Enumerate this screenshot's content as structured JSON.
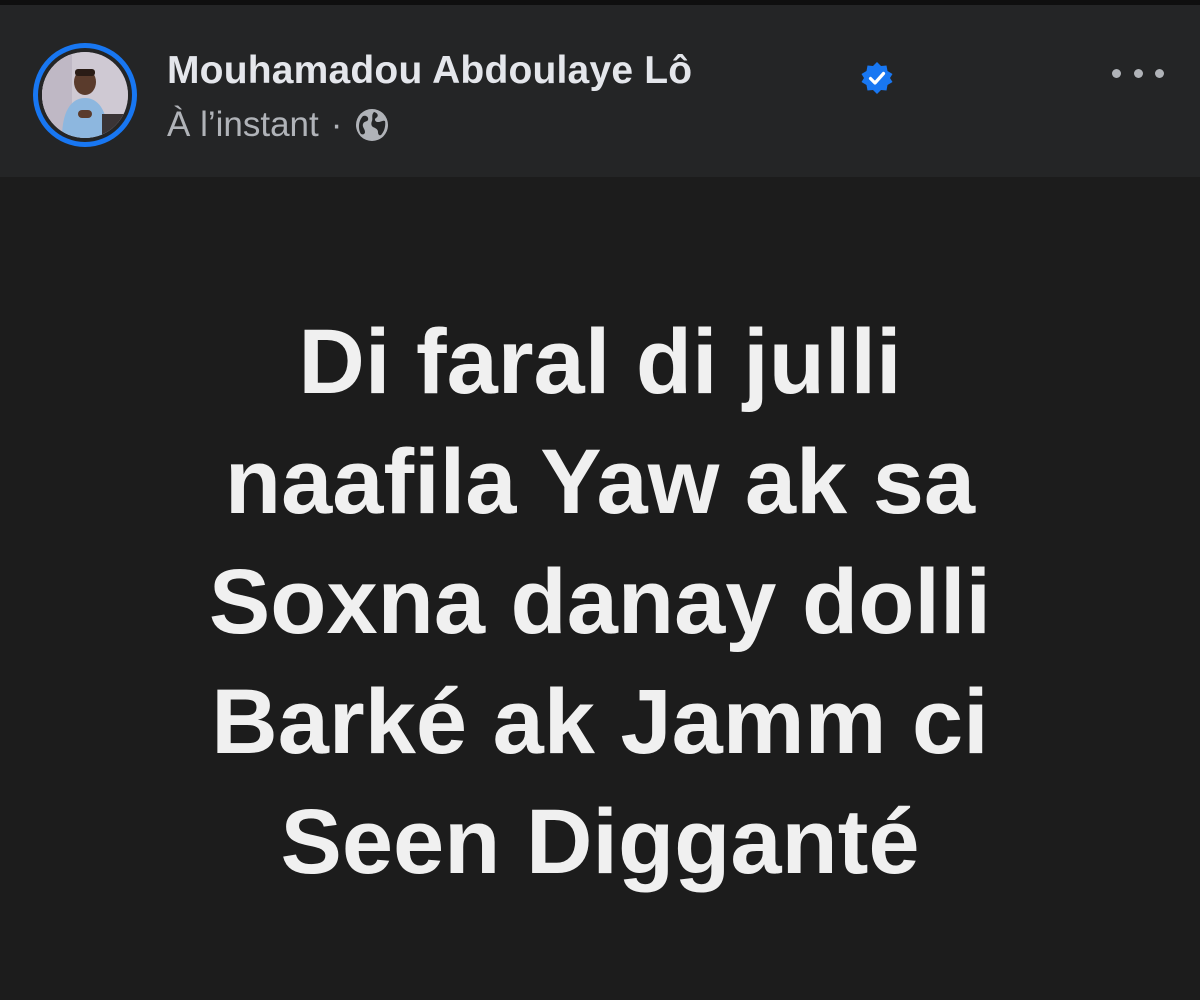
{
  "post": {
    "author_name": "Mouhamadou Abdoulaye Lô",
    "verified": true,
    "timestamp": "À l’instant",
    "separator": "·",
    "audience_icon": "globe-icon",
    "more_icon": "more-options-icon",
    "avatar": "author-avatar",
    "text": "Di faral di julli\nnaafila Yaw ak  sa\nSoxna danay dolli\nBarké ak Jamm ci\nSeen Digganté"
  },
  "colors": {
    "header_background": "#242526",
    "body_background": "#1c1c1c",
    "accent": "#1877f2",
    "text_primary": "#e4e6eb",
    "text_secondary": "#b0b3b8"
  }
}
